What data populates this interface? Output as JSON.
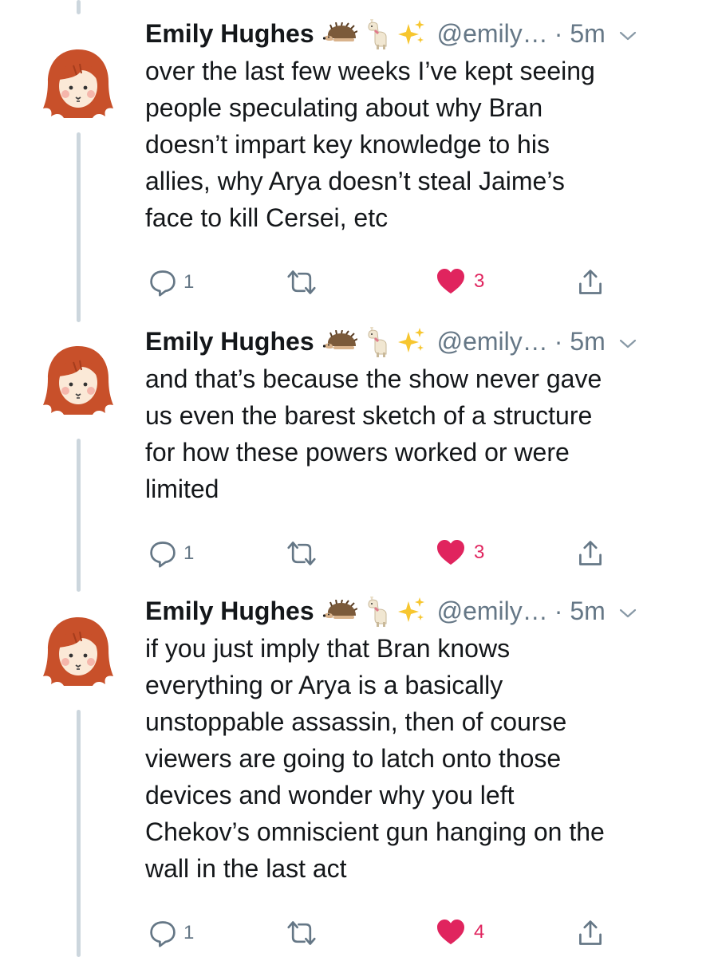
{
  "tweets": [
    {
      "author_name": "Emily Hughes",
      "handle": "@emily…",
      "time": "· 5m",
      "text": [
        "over the last few weeks I’ve kept seeing",
        "people speculating about why Bran",
        "doesn’t impart key knowledge to his",
        "allies, why Arya doesn’t steal Jaime’s",
        "face to kill Cersei, etc"
      ],
      "reply_count": "1",
      "like_count": "3",
      "liked": true
    },
    {
      "author_name": "Emily Hughes",
      "handle": "@emily…",
      "time": "· 5m",
      "text": [
        "and that’s because the show never gave",
        "us even the barest sketch of a structure",
        "for how these powers worked or were",
        "limited"
      ],
      "reply_count": "1",
      "like_count": "3",
      "liked": true
    },
    {
      "author_name": "Emily Hughes",
      "handle": "@emily…",
      "time": "· 5m",
      "text": [
        "if you just imply that Bran knows",
        "everything or Arya is a basically",
        "unstoppable assassin, then of course",
        "viewers are going to latch onto those",
        "devices and wonder why you left",
        "Chekov’s omniscient gun hanging on the",
        "wall in the last act"
      ],
      "reply_count": "1",
      "like_count": "4",
      "liked": true
    }
  ],
  "name_emojis": [
    "hedgehog-emoji",
    "llama-emoji",
    "sparkles-emoji"
  ],
  "colors": {
    "text": "#14171a",
    "secondary": "#657786",
    "like": "#e0245e",
    "thread_line": "#ccd6dd",
    "avatar_hair": "#c8502a"
  }
}
